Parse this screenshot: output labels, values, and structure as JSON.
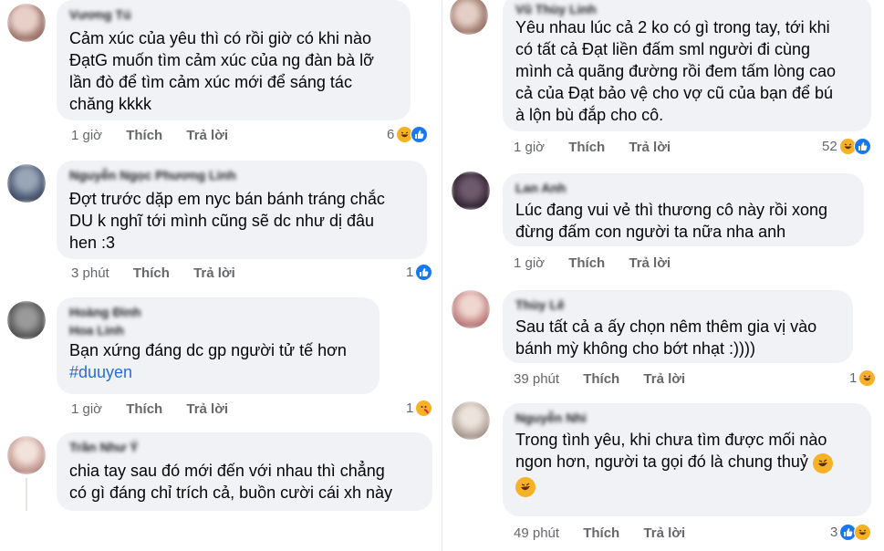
{
  "left": [
    {
      "name": "Vương Tú",
      "lines": [
        "Cảm xúc của yêu thì có rồi giờ có khi nào",
        "ĐạtG muốn tìm cảm xúc của ng đàn bà lỡ",
        "lần đò để tìm cảm xúc mới để sáng tác",
        "chăng kkkk"
      ],
      "time": "1 giờ",
      "like_label": "Thích",
      "reply_label": "Trả lời",
      "count": "6",
      "reactions": [
        "haha",
        "like"
      ],
      "avatar_color": "#c9a7a0"
    },
    {
      "name": "Nguyễn Ngọc Phương Linh",
      "lines": [
        "Đợt trước dặp em nyc bán bánh tráng chắc",
        "DU k nghĩ tới mình cũng sẽ dc như dị đâu",
        "hen :3"
      ],
      "time": "3 phút",
      "like_label": "Thích",
      "reply_label": "Trả lời",
      "count": "1",
      "reactions": [
        "like"
      ],
      "avatar_color": "#5b6e8c"
    },
    {
      "name": "Hoàng Đình",
      "name2": "Hoa Linh",
      "lines": [
        "Bạn xứng đáng dc gp người tử tế hơn"
      ],
      "hashtag": "#duuyen",
      "time": "1 giờ",
      "like_label": "Thích",
      "reply_label": "Trả lời",
      "count": "1",
      "reactions": [
        "care"
      ],
      "avatar_color": "#6b6b6b"
    },
    {
      "name": "Trần Như Ý",
      "lines": [
        "chia tay sau đó mới đến với nhau thì chẳng",
        "có gì đáng chỉ trích cả, buồn cười cái xh này"
      ],
      "avatar_color": "#d8b8b0"
    }
  ],
  "right": [
    {
      "name": "Vũ Thùy Linh",
      "lines": [
        "Yêu nhau lúc cả 2 ko có gì trong tay, tới khi",
        "có tất cả Đạt liền đấm sml người đi cùng",
        "mình cả quãng đường rồi đem tấm lòng cao",
        "cả của Đạt bảo vệ cho vợ cũ của bạn để bú",
        "à lộn bù đắp cho cô."
      ],
      "time": "1 giờ",
      "like_label": "Thích",
      "reply_label": "Trả lời",
      "count": "52",
      "reactions": [
        "haha",
        "like"
      ],
      "avatar_color": "#b79a8e"
    },
    {
      "name": "Lan Anh",
      "lines": [
        "Lúc đang vui vẻ thì thương cô này rồi xong",
        "đừng đấm con người ta nữa nha anh"
      ],
      "time": "1 giờ",
      "like_label": "Thích",
      "reply_label": "Trả lời",
      "avatar_color": "#4a3b4a"
    },
    {
      "name": "Thùy Lê",
      "lines": [
        "Sau tất cả a ấy chọn nêm thêm gia vị vào",
        "bánh mỳ không cho bớt nhạt :))))"
      ],
      "time": "39 phút",
      "like_label": "Thích",
      "reply_label": "Trả lời",
      "count": "1",
      "reactions": [
        "haha"
      ],
      "avatar_color": "#c28a8a"
    },
    {
      "name": "Nguyễn Nhi",
      "lines": [
        "Trong tình yêu, khi chưa tìm được mối nào",
        "ngon hơn, người ta gọi đó là chung thuỷ"
      ],
      "time": "49 phút",
      "like_label": "Thích",
      "reply_label": "Trả lời",
      "count": "3",
      "reactions": [
        "like",
        "haha"
      ],
      "avatar_color": "#b8a9a0"
    }
  ],
  "colors": {
    "bubble": "#f0f2f5",
    "meta": "#65676b",
    "hashtag": "#216fdb",
    "like": "#1877f2",
    "haha": "#f7b125"
  }
}
